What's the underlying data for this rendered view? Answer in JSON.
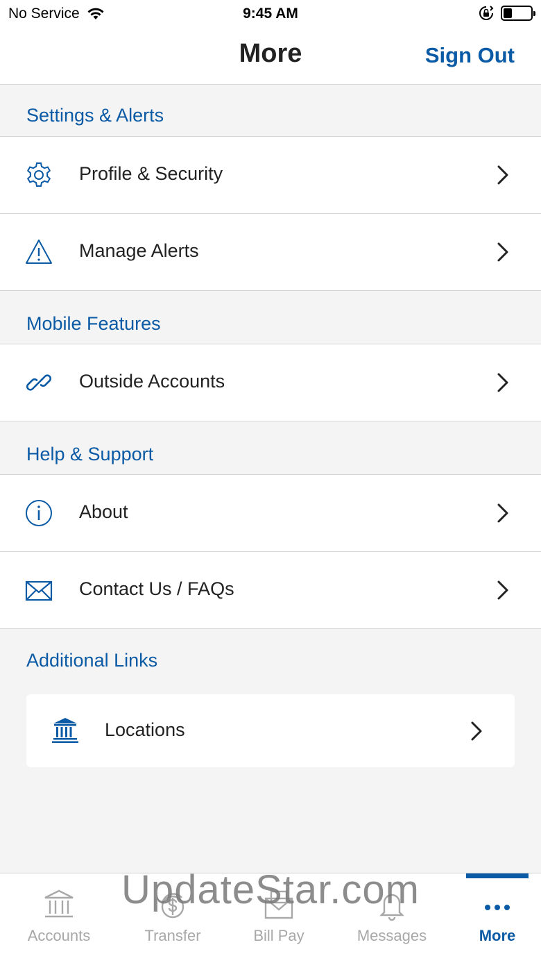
{
  "status_bar": {
    "carrier": "No Service",
    "time": "9:45 AM"
  },
  "nav": {
    "title": "More",
    "sign_out": "Sign Out"
  },
  "sections": {
    "settings": "Settings & Alerts",
    "mobile": "Mobile Features",
    "help": "Help & Support",
    "additional": "Additional Links"
  },
  "items": {
    "profile": "Profile & Security",
    "alerts": "Manage Alerts",
    "outside": "Outside Accounts",
    "about": "About",
    "contact": "Contact Us / FAQs",
    "locations": "Locations"
  },
  "tabs": [
    {
      "label": "Accounts"
    },
    {
      "label": "Transfer"
    },
    {
      "label": "Bill Pay"
    },
    {
      "label": "Messages"
    },
    {
      "label": "More"
    }
  ],
  "watermark": "UpdateStar.com",
  "colors": {
    "accent": "#0a5aa5",
    "inactive": "#a8a8a8",
    "background": "#f4f4f4"
  }
}
